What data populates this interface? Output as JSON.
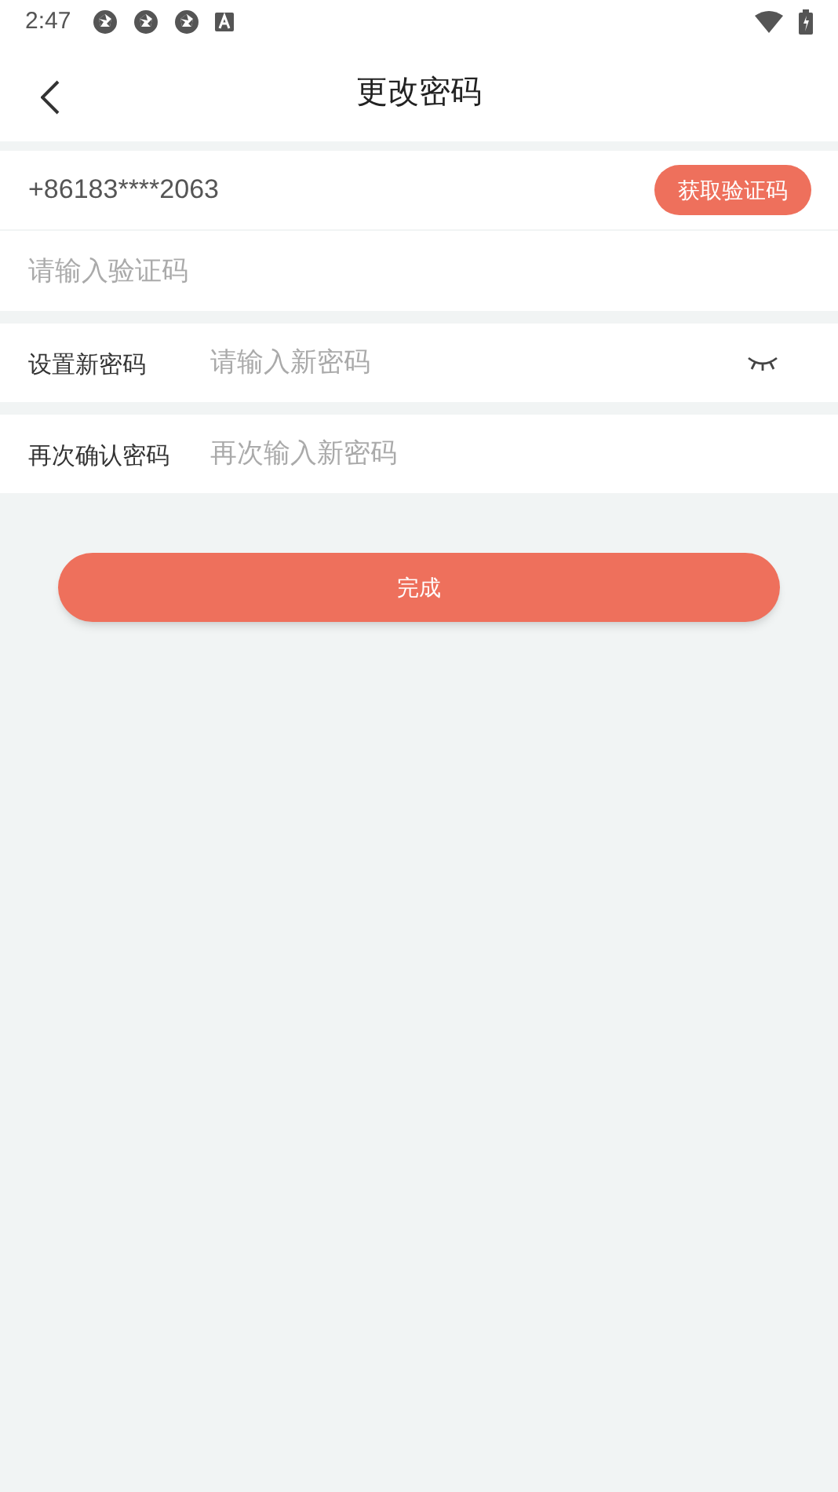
{
  "status_bar": {
    "time": "2:47"
  },
  "header": {
    "title": "更改密码"
  },
  "phone_row": {
    "phone": "+86183****2063",
    "button": "获取验证码"
  },
  "code_field": {
    "placeholder": "请输入验证码"
  },
  "password_rows": [
    {
      "label": "设置新密码",
      "placeholder": "请输入新密码",
      "revealed": false
    },
    {
      "label": "再次确认密码",
      "placeholder": "再次输入新密码"
    }
  ],
  "submit_button": "完成"
}
